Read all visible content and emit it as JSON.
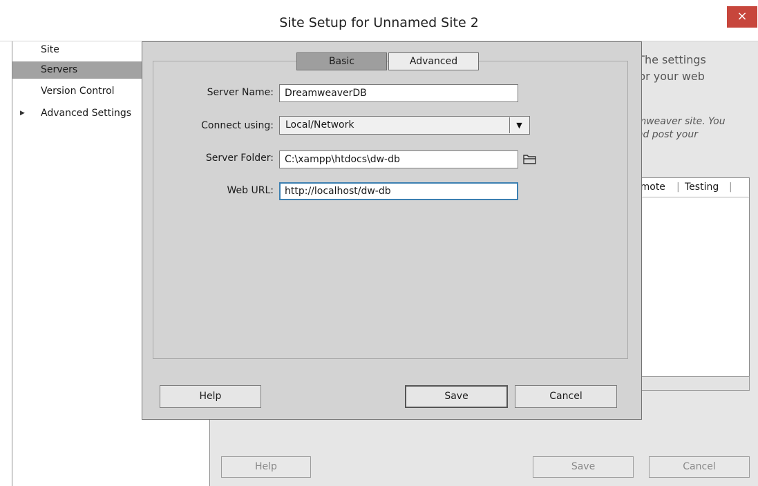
{
  "window": {
    "title": "Site Setup for Unnamed Site 2",
    "close_glyph": "×"
  },
  "sidebar": {
    "items": [
      {
        "label": "Site"
      },
      {
        "label": "Servers"
      },
      {
        "label": "Version Control"
      },
      {
        "label": "Advanced Settings"
      }
    ],
    "expand_glyph": "▶"
  },
  "background": {
    "description_top": ". The settings\n) or your web",
    "description_italic": "amweaver site. You\nand post your",
    "list_headers": [
      "emote",
      "Testing"
    ],
    "help_label": "Help",
    "save_label": "Save",
    "cancel_label": "Cancel"
  },
  "dialog": {
    "tabs": [
      "Basic",
      "Advanced"
    ],
    "server_name_label": "Server Name:",
    "server_name_value": "DreamweaverDB",
    "connect_label": "Connect using:",
    "connect_value": "Local/Network",
    "folder_label": "Server Folder:",
    "folder_value": "C:\\xampp\\htdocs\\dw-db",
    "url_label": "Web URL:",
    "url_value": "http://localhost/dw-db",
    "help_label": "Help",
    "save_label": "Save",
    "cancel_label": "Cancel",
    "dropdown_glyph": "▼"
  },
  "colors": {
    "close_button": "#c7463c",
    "selected_item": "#a2a2a2",
    "focus_border": "#3c7fb1"
  }
}
